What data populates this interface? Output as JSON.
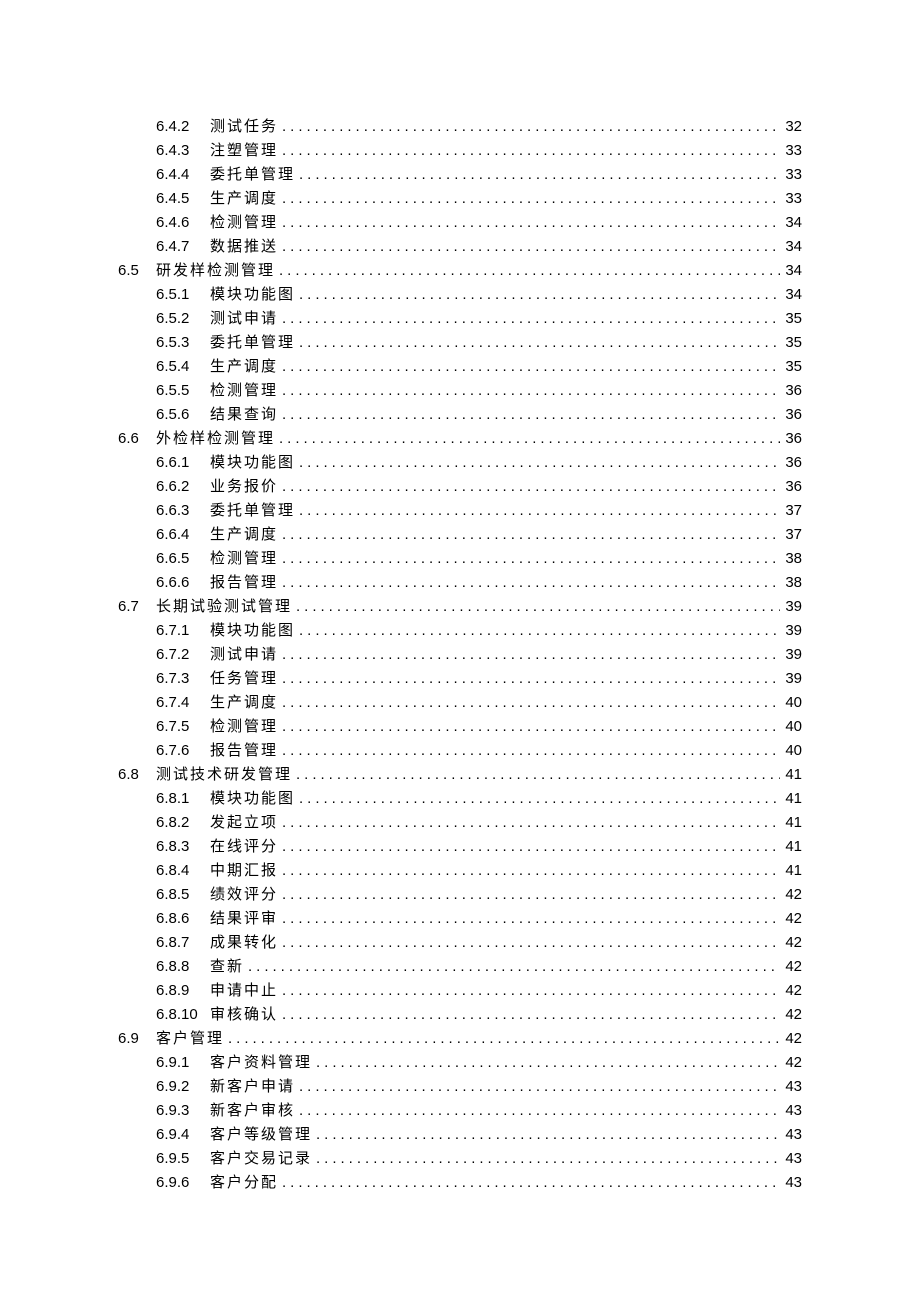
{
  "toc": [
    {
      "level": 3,
      "sub": "6.4.2",
      "title": "测试任务",
      "page": "32"
    },
    {
      "level": 3,
      "sub": "6.4.3",
      "title": "注塑管理",
      "page": "33"
    },
    {
      "level": 3,
      "sub": "6.4.4",
      "title": "委托单管理",
      "page": "33"
    },
    {
      "level": 3,
      "sub": "6.4.5",
      "title": "生产调度",
      "page": "33"
    },
    {
      "level": 3,
      "sub": "6.4.6",
      "title": "检测管理",
      "page": "34"
    },
    {
      "level": 3,
      "sub": "6.4.7",
      "title": "数据推送",
      "page": "34"
    },
    {
      "level": 2,
      "sec": "6.5",
      "title": "研发样检测管理",
      "page": "34"
    },
    {
      "level": 3,
      "sub": "6.5.1",
      "title": "模块功能图",
      "page": "34"
    },
    {
      "level": 3,
      "sub": "6.5.2",
      "title": "测试申请",
      "page": "35"
    },
    {
      "level": 3,
      "sub": "6.5.3",
      "title": "委托单管理",
      "page": "35"
    },
    {
      "level": 3,
      "sub": "6.5.4",
      "title": "生产调度",
      "page": "35"
    },
    {
      "level": 3,
      "sub": "6.5.5",
      "title": "检测管理",
      "page": "36"
    },
    {
      "level": 3,
      "sub": "6.5.6",
      "title": "结果查询",
      "page": "36"
    },
    {
      "level": 2,
      "sec": "6.6",
      "title": "外检样检测管理",
      "page": "36"
    },
    {
      "level": 3,
      "sub": "6.6.1",
      "title": "模块功能图",
      "page": "36"
    },
    {
      "level": 3,
      "sub": "6.6.2",
      "title": "业务报价",
      "page": "36"
    },
    {
      "level": 3,
      "sub": "6.6.3",
      "title": "委托单管理",
      "page": "37"
    },
    {
      "level": 3,
      "sub": "6.6.4",
      "title": "生产调度",
      "page": "37"
    },
    {
      "level": 3,
      "sub": "6.6.5",
      "title": "检测管理",
      "page": "38"
    },
    {
      "level": 3,
      "sub": "6.6.6",
      "title": "报告管理",
      "page": "38"
    },
    {
      "level": 2,
      "sec": "6.7",
      "title": "长期试验测试管理",
      "page": "39"
    },
    {
      "level": 3,
      "sub": "6.7.1",
      "title": "模块功能图",
      "page": "39"
    },
    {
      "level": 3,
      "sub": "6.7.2",
      "title": "测试申请",
      "page": "39"
    },
    {
      "level": 3,
      "sub": "6.7.3",
      "title": "任务管理",
      "page": "39"
    },
    {
      "level": 3,
      "sub": "6.7.4",
      "title": "生产调度",
      "page": "40"
    },
    {
      "level": 3,
      "sub": "6.7.5",
      "title": "检测管理",
      "page": "40"
    },
    {
      "level": 3,
      "sub": "6.7.6",
      "title": "报告管理",
      "page": "40"
    },
    {
      "level": 2,
      "sec": "6.8",
      "title": "测试技术研发管理",
      "page": "41"
    },
    {
      "level": 3,
      "sub": "6.8.1",
      "title": "模块功能图",
      "page": "41"
    },
    {
      "level": 3,
      "sub": "6.8.2",
      "title": "发起立项",
      "page": "41"
    },
    {
      "level": 3,
      "sub": "6.8.3",
      "title": "在线评分",
      "page": "41"
    },
    {
      "level": 3,
      "sub": "6.8.4",
      "title": "中期汇报",
      "page": "41"
    },
    {
      "level": 3,
      "sub": "6.8.5",
      "title": "绩效评分",
      "page": "42"
    },
    {
      "level": 3,
      "sub": "6.8.6",
      "title": "结果评审",
      "page": "42"
    },
    {
      "level": 3,
      "sub": "6.8.7",
      "title": "成果转化",
      "page": "42"
    },
    {
      "level": 3,
      "sub": "6.8.8",
      "title": "查新",
      "page": "42"
    },
    {
      "level": 3,
      "sub": "6.8.9",
      "title": "申请中止",
      "page": "42"
    },
    {
      "level": 3,
      "sub": "6.8.10",
      "title": "审核确认",
      "page": "42"
    },
    {
      "level": 2,
      "sec": "6.9",
      "title": "客户管理",
      "page": "42"
    },
    {
      "level": 3,
      "sub": "6.9.1",
      "title": "客户资料管理",
      "page": "42"
    },
    {
      "level": 3,
      "sub": "6.9.2",
      "title": "新客户申请",
      "page": "43"
    },
    {
      "level": 3,
      "sub": "6.9.3",
      "title": "新客户审核",
      "page": "43"
    },
    {
      "level": 3,
      "sub": "6.9.4",
      "title": "客户等级管理",
      "page": "43"
    },
    {
      "level": 3,
      "sub": "6.9.5",
      "title": "客户交易记录",
      "page": "43"
    },
    {
      "level": 3,
      "sub": "6.9.6",
      "title": "客户分配",
      "page": "43"
    }
  ]
}
